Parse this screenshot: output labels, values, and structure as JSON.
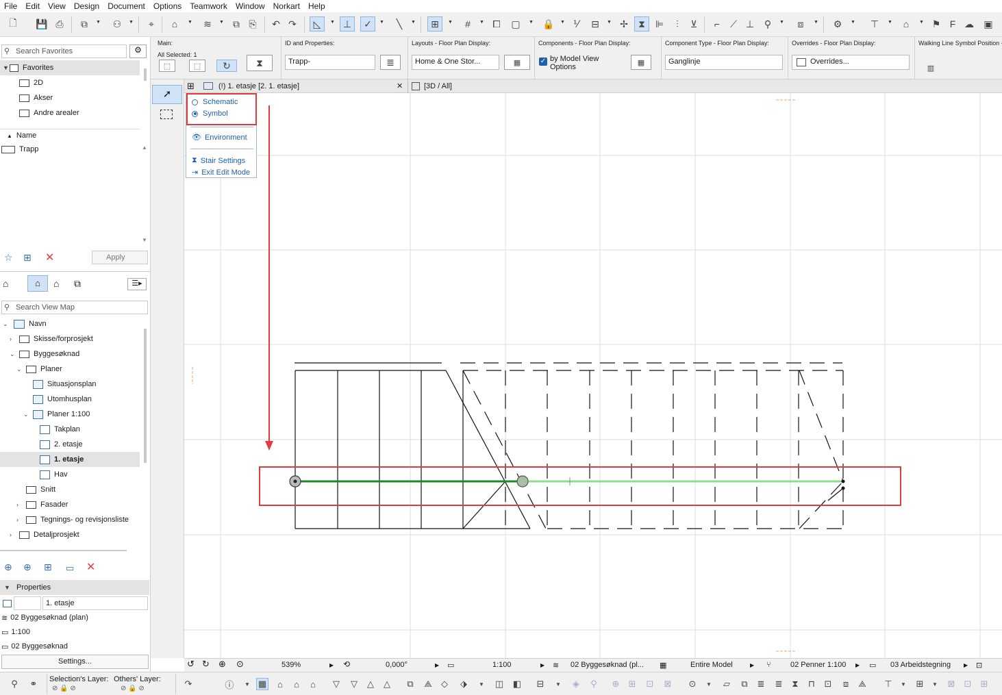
{
  "menu": [
    "File",
    "Edit",
    "View",
    "Design",
    "Document",
    "Options",
    "Teamwork",
    "Window",
    "Norkart",
    "Help"
  ],
  "infobox": {
    "main_label": "Main:",
    "all_selected": "All Selected: 1",
    "id_label": "ID and Properties:",
    "id_value": "Trapp-",
    "layouts_label": "Layouts - Floor Plan Display:",
    "layouts_value": "Home & One Stor...",
    "components_label": "Components - Floor Plan Display:",
    "components_value": "by Model View Options",
    "component_type_label": "Component Type - Floor Plan Display:",
    "component_type_value": "Ganglinje",
    "overrides_label": "Overrides - Floor Plan Display:",
    "overrides_value": "Overrides...",
    "walking_line_label": "Walking Line Symbol Position - F"
  },
  "favorites": {
    "search_placeholder": "Search Favorites",
    "header": "Favorites",
    "items": [
      "2D",
      "Akser",
      "Andre arealer"
    ],
    "name_col": "Name",
    "list": [
      "Trapp"
    ],
    "apply": "Apply"
  },
  "viewmap": {
    "search_placeholder": "Search View Map",
    "root": "Navn",
    "items": [
      "Skisse/forprosjekt",
      "Byggesøknad",
      "Planer",
      "Situasjonsplan",
      "Utomhusplan",
      "Planer 1:100",
      "Takplan",
      "2. etasje",
      "1. etasje",
      "Hav",
      "Snitt",
      "Fasader",
      "Tegnings- og revisjonsliste",
      "Detaljprosjekt"
    ]
  },
  "properties": {
    "header": "Properties",
    "name_value": "1. etasje",
    "layer": "02 Byggesøknad (plan)",
    "scale": "1:100",
    "set": "02 Byggesøknad",
    "settings_button": "Settings..."
  },
  "tabs": {
    "plan_tab": "(!) 1. etasje [2. 1. etasje]",
    "threeD_tab": "[3D / All]"
  },
  "stair_menu": {
    "schematic": "Schematic",
    "symbol": "Symbol",
    "environment": "Environment",
    "stair_settings": "Stair Settings",
    "exit_edit": "Exit Edit Mode"
  },
  "status": {
    "zoom": "539%",
    "angle": "0,000°",
    "scale": "1:100",
    "layer_combo": "02 Byggesøknad (pl...",
    "model": "Entire Model",
    "pens": "02 Penner 1:100",
    "view": "03 Arbeidstegning"
  },
  "bottom": {
    "selection_layer": "Selection's Layer:",
    "others_layer": "Others' Layer:"
  },
  "colors": {
    "accent_blue": "#1f5fad",
    "highlight_red": "#e23b3b",
    "walking_line_dark": "#1b8a2a",
    "walking_line_light": "#8fdc8a"
  }
}
